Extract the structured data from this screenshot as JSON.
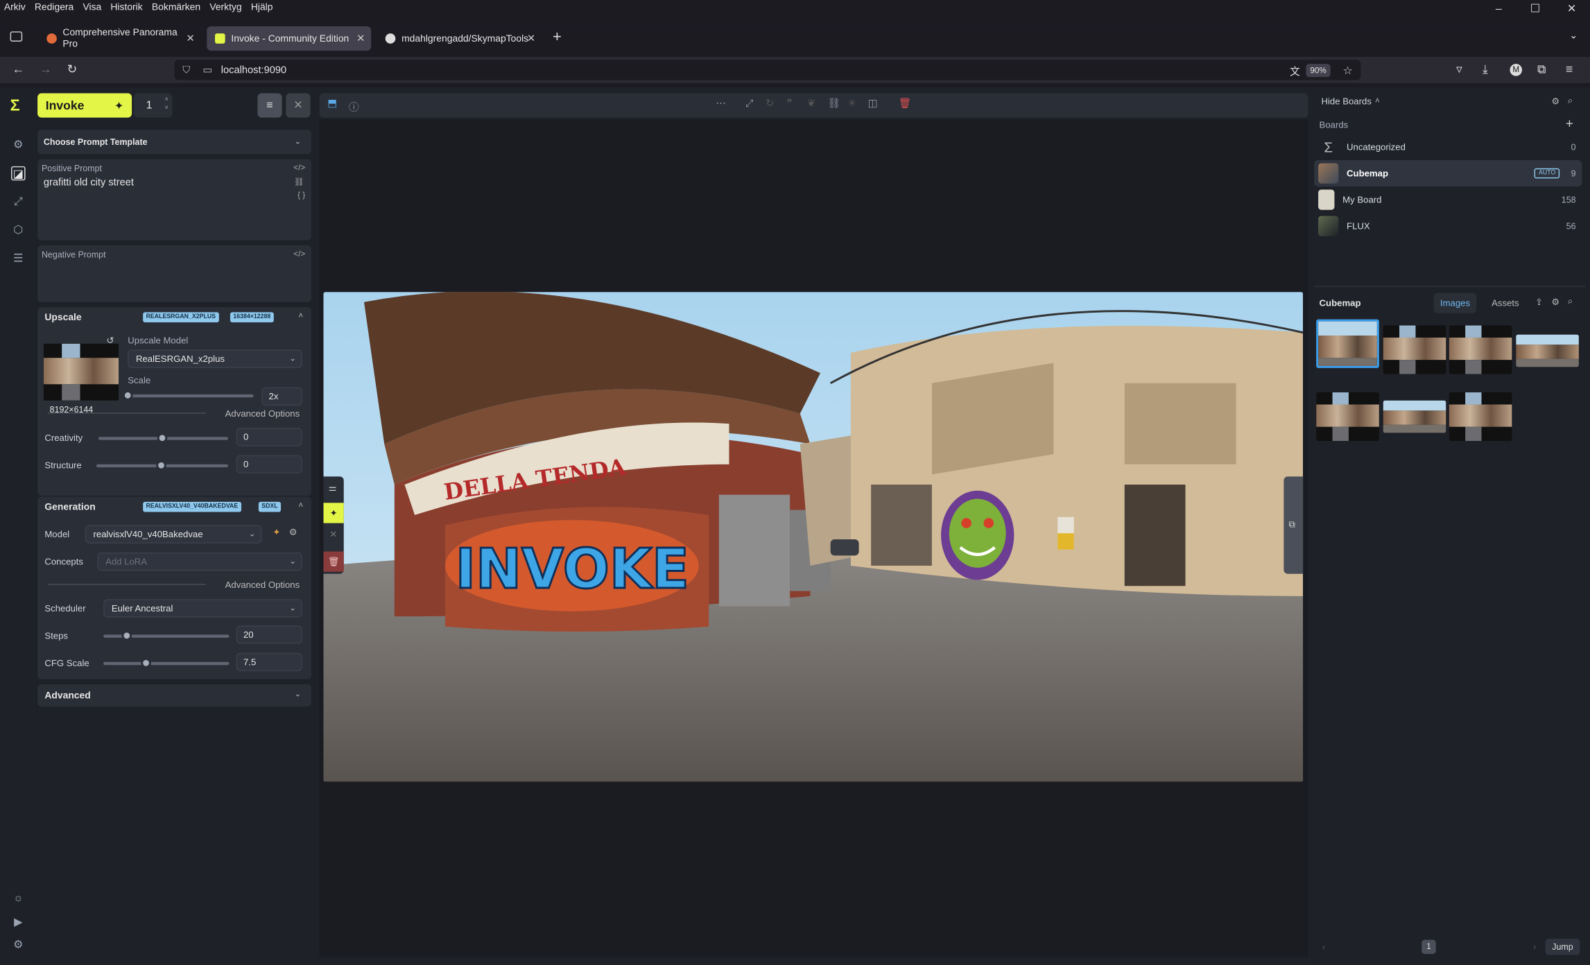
{
  "browser": {
    "menu": [
      "Arkiv",
      "Redigera",
      "Visa",
      "Historik",
      "Bokmärken",
      "Verktyg",
      "Hjälp"
    ],
    "tabs": [
      {
        "label": "Comprehensive Panorama Pro"
      },
      {
        "label": "Invoke - Community Edition"
      },
      {
        "label": "mdahlgrengadd/SkymapTools"
      }
    ],
    "url": "localhost:9090",
    "zoom": "90%"
  },
  "app": {
    "invoke_label": "Invoke",
    "batch_count": "1",
    "prompt_template": "Choose Prompt Template",
    "positive_prompt_label": "Positive Prompt",
    "positive_prompt_value": "grafitti old city street",
    "negative_prompt_label": "Negative Prompt",
    "upscale": {
      "title": "Upscale",
      "badge_model": "REALESRGAN_X2PLUS",
      "badge_size": "16384×12288",
      "image_size": "8192×6144",
      "model_label": "Upscale Model",
      "model_value": "RealESRGAN_x2plus",
      "scale_label": "Scale",
      "scale_value": "2x",
      "advanced_options": "Advanced Options",
      "creativity_label": "Creativity",
      "creativity_value": "0",
      "structure_label": "Structure",
      "structure_value": "0"
    },
    "generation": {
      "title": "Generation",
      "badge_model": "REALVISXLV40_V40BAKEDVAE",
      "badge_type": "SDXL",
      "model_label": "Model",
      "model_value": "realvisxlV40_v40Bakedvae",
      "concepts_label": "Concepts",
      "concepts_placeholder": "Add LoRA",
      "advanced_options": "Advanced Options",
      "scheduler_label": "Scheduler",
      "scheduler_value": "Euler Ancestral",
      "steps_label": "Steps",
      "steps_value": "20",
      "cfg_label": "CFG Scale",
      "cfg_value": "7.5"
    },
    "advanced_label": "Advanced"
  },
  "boards": {
    "hide_label": "Hide Boards",
    "section_label": "Boards",
    "items": [
      {
        "name": "Uncategorized",
        "count": "0"
      },
      {
        "name": "Cubemap",
        "count": "9",
        "tag": "AUTO"
      },
      {
        "name": "My Board",
        "count": "158"
      },
      {
        "name": "FLUX",
        "count": "56"
      }
    ]
  },
  "gallery": {
    "title": "Cubemap",
    "tab_images": "Images",
    "tab_assets": "Assets",
    "page": "1",
    "jump_label": "Jump"
  },
  "colors": {
    "accent": "#e3f547",
    "badge": "#8ec8ec",
    "selected_border": "#3b9eea"
  }
}
